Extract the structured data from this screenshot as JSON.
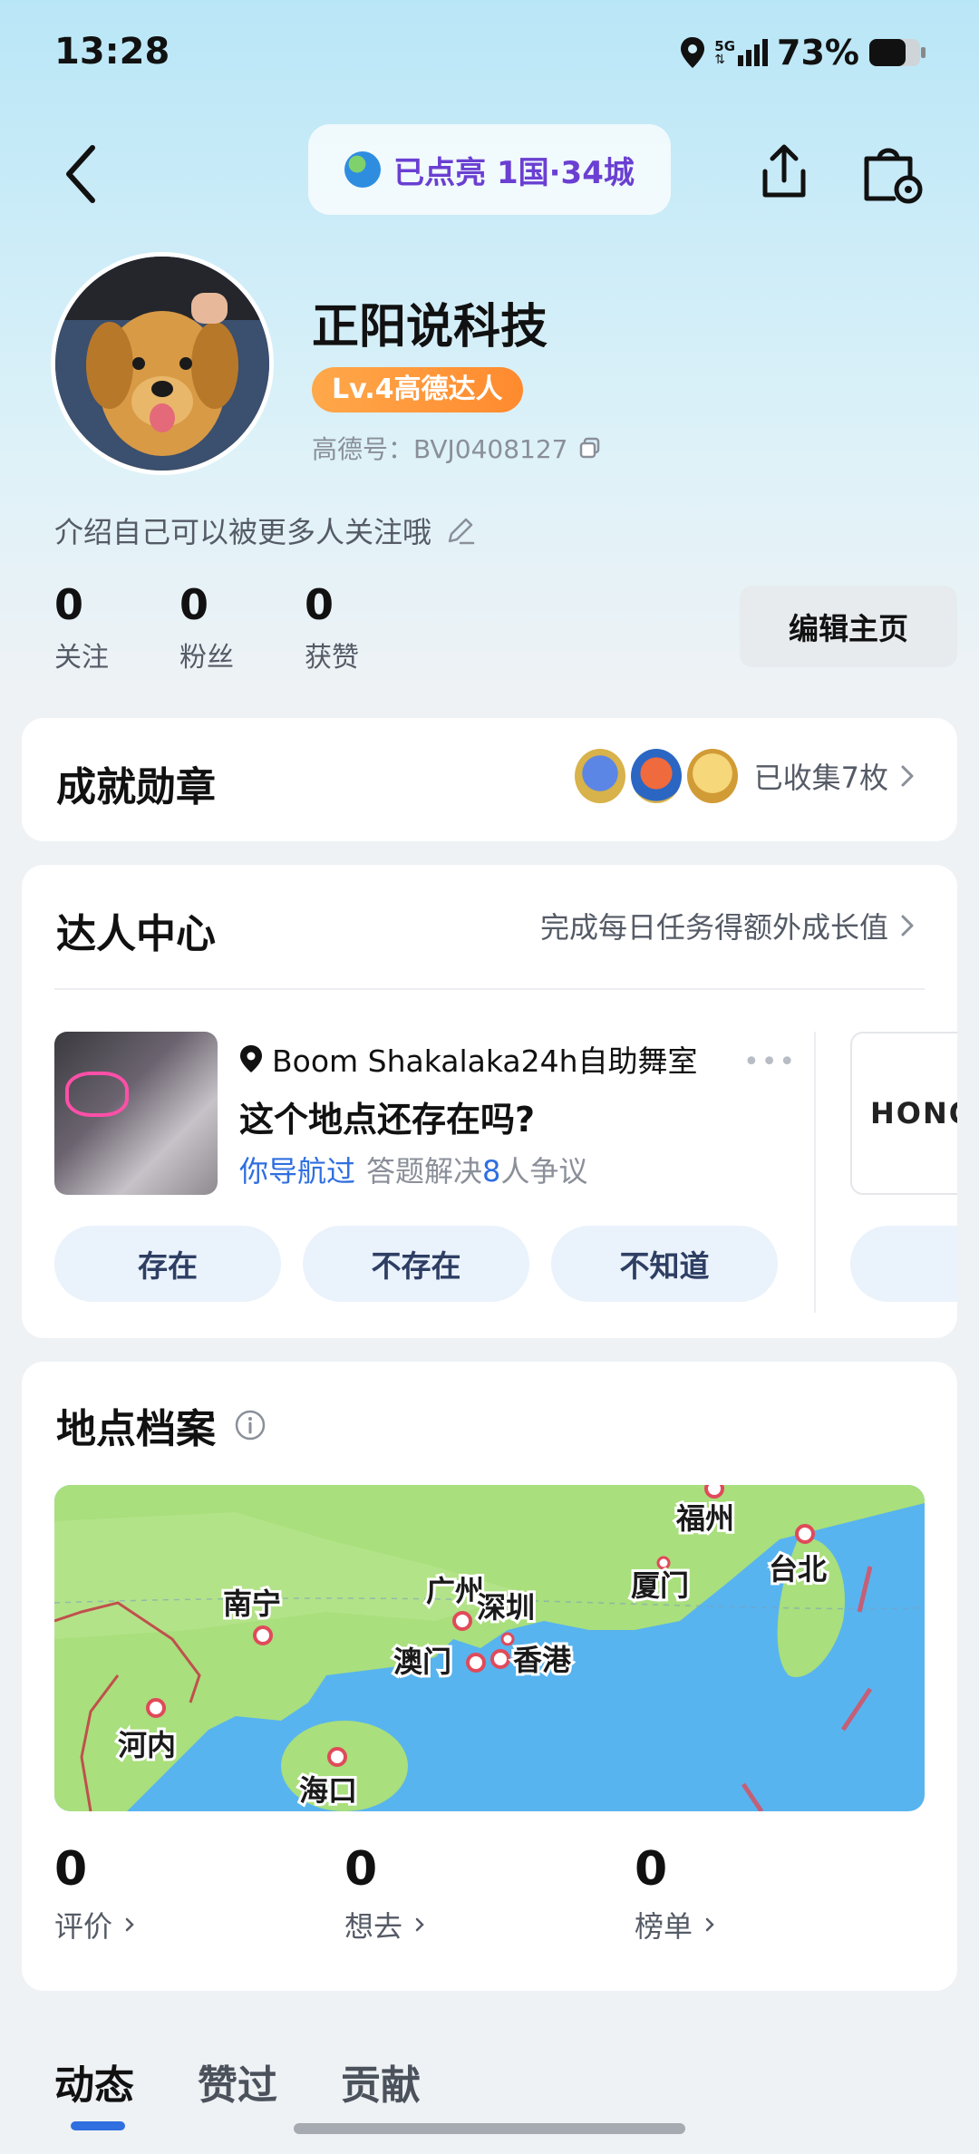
{
  "status_bar": {
    "time": "13:28",
    "network": "5G",
    "battery_percent": "73%"
  },
  "header": {
    "lit_badge": "已点亮 1国·34城"
  },
  "profile": {
    "name": "正阳说科技",
    "level_badge": "Lv.4高德达人",
    "amap_id": "高德号：BVJ0408127",
    "bio": "介绍自己可以被更多人关注哦",
    "edit_button": "编辑主页",
    "stats": [
      {
        "value": "0",
        "label": "关注"
      },
      {
        "value": "0",
        "label": "粉丝"
      },
      {
        "value": "0",
        "label": "获赞"
      }
    ]
  },
  "achievements": {
    "title": "成就勋章",
    "collected": "已收集7枚"
  },
  "expert_center": {
    "title": "达人中心",
    "subtitle": "完成每日任务得额外成长值",
    "question": {
      "place": "Boom Shakalaka24h自助舞室",
      "more": "•••",
      "text": "这个地点还存在吗?",
      "nav_tag": "你导航过",
      "meta_prefix": "答题解决",
      "meta_count": "8",
      "meta_suffix": "人争议",
      "options": [
        "存在",
        "不存在",
        "不知道"
      ]
    },
    "next_card_brand": "HONOR"
  },
  "place_archive": {
    "title": "地点档案",
    "map_cities": [
      "福州",
      "台北",
      "厦门",
      "广州",
      "深圳",
      "南宁",
      "澳门",
      "香港",
      "河内",
      "海口"
    ],
    "stats": [
      {
        "value": "0",
        "label": "评价"
      },
      {
        "value": "0",
        "label": "想去"
      },
      {
        "value": "0",
        "label": "榜单"
      }
    ]
  },
  "tabs": [
    "动态",
    "赞过",
    "贡献"
  ],
  "colors": {
    "accent_blue": "#2f6fe0",
    "lit_purple": "#6a3fd2",
    "level_orange": "#ff8a2e"
  }
}
